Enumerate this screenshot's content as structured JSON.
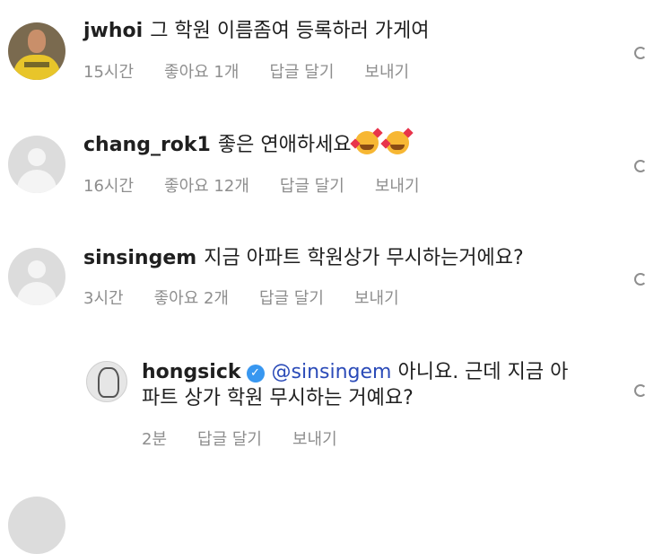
{
  "comments": [
    {
      "username": "jwhoi",
      "text": "그 학원 이름좀여 등록하러 가게여",
      "time": "15시간",
      "likes": "좋아요 1개",
      "reply": "답글 달기",
      "send": "보내기"
    },
    {
      "username": "chang_rok1",
      "text": "좋은 연애하세요",
      "time": "16시간",
      "likes": "좋아요 12개",
      "reply": "답글 달기",
      "send": "보내기"
    },
    {
      "username": "sinsingem",
      "text": "지금 아파트 학원상가 무시하는거에요?",
      "time": "3시간",
      "likes": "좋아요 2개",
      "reply": "답글 달기",
      "send": "보내기"
    }
  ],
  "reply": {
    "username": "hongsick",
    "mention": "@sinsingem",
    "line1": "아니요. 근데 지금 아",
    "line2": "파트 상가 학원 무시하는 거예요?",
    "time": "2분",
    "reply": "답글 달기",
    "send": "보내기"
  }
}
